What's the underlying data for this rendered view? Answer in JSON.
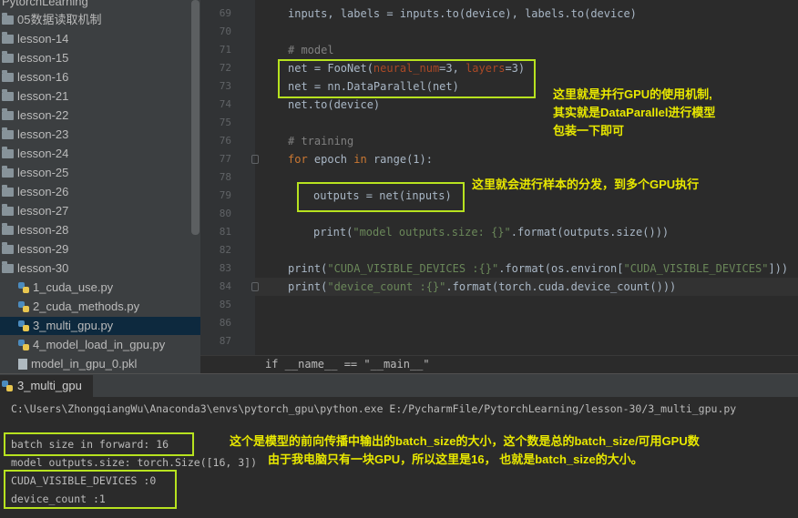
{
  "sidebar": {
    "project_name": "PytorchLearning",
    "folders": [
      {
        "label": "05数据读取机制"
      },
      {
        "label": "lesson-14"
      },
      {
        "label": "lesson-15"
      },
      {
        "label": "lesson-16"
      },
      {
        "label": "lesson-21"
      },
      {
        "label": "lesson-22"
      },
      {
        "label": "lesson-23"
      },
      {
        "label": "lesson-24"
      },
      {
        "label": "lesson-25"
      },
      {
        "label": "lesson-26"
      },
      {
        "label": "lesson-27"
      },
      {
        "label": "lesson-28"
      },
      {
        "label": "lesson-29"
      },
      {
        "label": "lesson-30"
      }
    ],
    "files": [
      {
        "label": "1_cuda_use.py"
      },
      {
        "label": "2_cuda_methods.py"
      },
      {
        "label": "3_multi_gpu.py",
        "selected": true
      },
      {
        "label": "4_model_load_in_gpu.py"
      },
      {
        "label": "model_in_gpu_0.pkl"
      }
    ]
  },
  "editor": {
    "line_numbers": [
      "69",
      "70",
      "71",
      "72",
      "73",
      "74",
      "75",
      "76",
      "77",
      "78",
      "79",
      "80",
      "81",
      "82",
      "83",
      "84",
      "85",
      "86",
      "87"
    ],
    "code": {
      "l69": "inputs, labels = inputs.to(device), labels.to(device)",
      "l71": "# model",
      "l72a": "net = FooNet(",
      "l72b": "neural_num",
      "l72c": "=3, ",
      "l72d": "layers",
      "l72e": "=3)",
      "l73": "net = nn.DataParallel(net)",
      "l74": "net.to(device)",
      "l76": "# training",
      "l77a": "for",
      "l77b": " epoch ",
      "l77c": "in",
      "l77d": " range(1):",
      "l79": "outputs = net(inputs)",
      "l81a": "print(",
      "l81b": "\"model outputs.size: {}\"",
      "l81c": ".format(outputs.size()))",
      "l83a": "print(",
      "l83b": "\"CUDA_VISIBLE_DEVICES :{}\"",
      "l83c": ".format(os.environ[",
      "l83d": "\"CUDA_VISIBLE_DEVICES\"",
      "l83e": "]))",
      "l84a": "print(",
      "l84b": "\"device_count :{}\"",
      "l84c": ".format(torch.cuda.device_count()))"
    },
    "breadcrumb": "if __name__ == \"__main__\""
  },
  "annotations": {
    "a1_line1": "这里就是并行GPU的使用机制,",
    "a1_line2": "其实就是DataParallel进行模型",
    "a1_line3": "包装一下即可",
    "a2": "这里就会进行样本的分发，到多个GPU执行",
    "a3_line1": "这个是模型的前向传播中输出的batch_size的大小，这个数是总的batch_size/可用GPU数",
    "a3_line2": "由于我电脑只有一块GPU，所以这里是16， 也就是batch_size的大小。"
  },
  "run": {
    "tab_label": "3_multi_gpu",
    "command": "C:\\Users\\ZhongqiangWu\\Anaconda3\\envs\\pytorch_gpu\\python.exe E:/PycharmFile/PytorchLearning/lesson-30/3_multi_gpu.py",
    "output": [
      "batch size in forward: 16",
      "model outputs.size: torch.Size([16, 3])",
      "CUDA_VISIBLE_DEVICES :0",
      "device_count :1"
    ]
  },
  "colors": {
    "annotation_box": "#b7e21f",
    "annotation_text": "#e8e800"
  }
}
